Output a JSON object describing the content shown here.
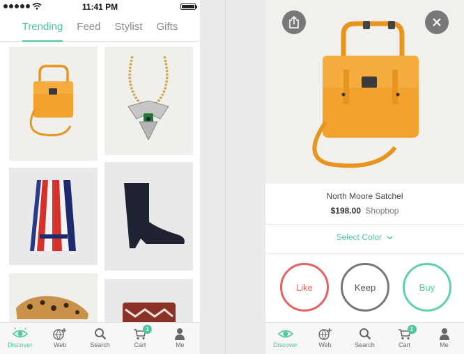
{
  "status_bar": {
    "time": "11:41 PM"
  },
  "top_tabs": [
    {
      "label": "Trending",
      "active": true
    },
    {
      "label": "Feed",
      "active": false
    },
    {
      "label": "Stylist",
      "active": false
    },
    {
      "label": "Gifts",
      "active": false
    }
  ],
  "grid_items": [
    {
      "name": "orange-satchel"
    },
    {
      "name": "jeweled-necklace"
    },
    {
      "name": "pleated-skirt"
    },
    {
      "name": "black-ankle-boot"
    },
    {
      "name": "leopard-slip-on"
    },
    {
      "name": "patterned-pillow"
    }
  ],
  "tabbar": {
    "items": [
      {
        "label": "Discover",
        "icon": "eye-icon",
        "active": true
      },
      {
        "label": "Web",
        "icon": "globe-plus-icon",
        "active": false
      },
      {
        "label": "Search",
        "icon": "search-icon",
        "active": false
      },
      {
        "label": "Cart",
        "icon": "cart-icon",
        "active": false,
        "badge": "1"
      },
      {
        "label": "Me",
        "icon": "person-icon",
        "active": false
      }
    ]
  },
  "product": {
    "name": "North Moore Satchel",
    "price": "$198.00",
    "store": "Shopbop",
    "select_color": "Select Color"
  },
  "actions": {
    "like": "Like",
    "keep": "Keep",
    "buy": "Buy"
  },
  "colors": {
    "accent": "#4fc79a",
    "like": "#e8605e",
    "keep": "#777777",
    "buy": "#5fd1a5",
    "bag": "#f2a22e"
  }
}
